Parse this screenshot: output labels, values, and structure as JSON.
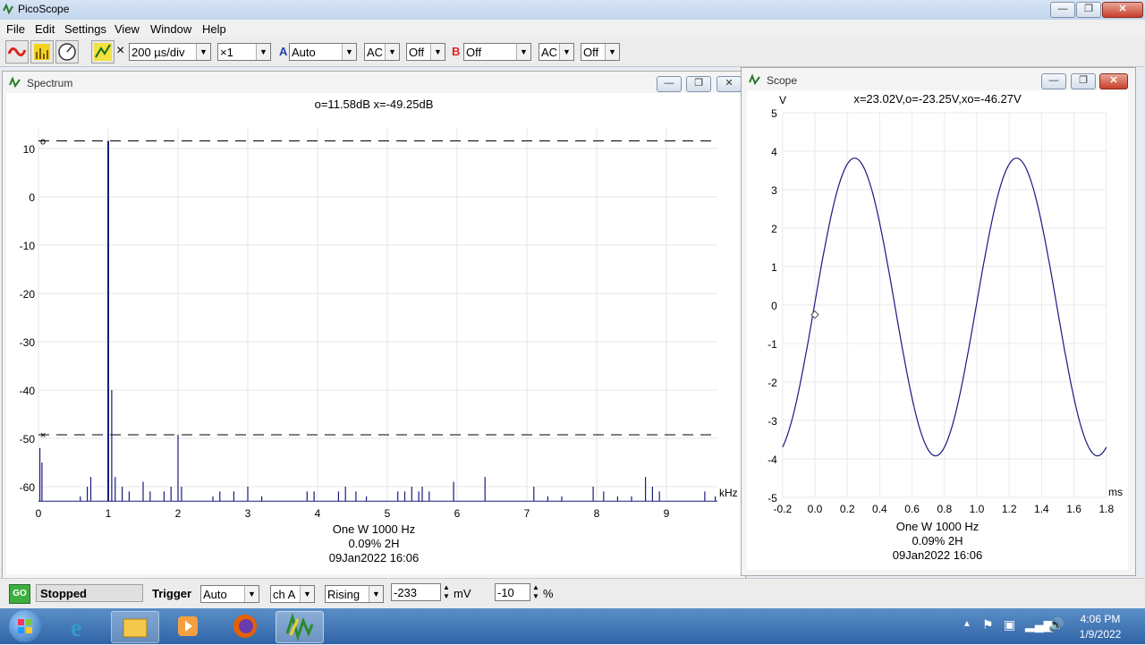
{
  "app": {
    "title": "PicoScope"
  },
  "menu": [
    "File",
    "Edit",
    "Settings",
    "View",
    "Window",
    "Help"
  ],
  "toolbar": {
    "x_symbol": "×",
    "timebase": "200 µs/div",
    "zoom": "×1",
    "channel_a": {
      "label": "A",
      "range": "Auto",
      "coupling": "AC",
      "extra": "Off"
    },
    "channel_b": {
      "label": "B",
      "range": "Off",
      "coupling": "AC",
      "extra": "Off"
    }
  },
  "spectrum": {
    "title": "Spectrum",
    "readout": "o=11.58dB  x=-49.25dB",
    "marker_o": "o",
    "marker_x": "×",
    "y_ticks": [
      "10",
      "0",
      "-10",
      "-20",
      "-30",
      "-40",
      "-50",
      "-60"
    ],
    "x_ticks": [
      "0",
      "1",
      "2",
      "3",
      "4",
      "5",
      "6",
      "7",
      "8",
      "9"
    ],
    "x_unit": "kHz",
    "info_line1": "One W 1000 Hz",
    "info_line2": "0.09% 2H",
    "info_line3": "09Jan2022  16:06"
  },
  "scope": {
    "title": "Scope",
    "y_unit": "V",
    "readout": "x=23.02V,o=-23.25V,xo=-46.27V",
    "y_ticks": [
      "5",
      "4",
      "3",
      "2",
      "1",
      "0",
      "-1",
      "-2",
      "-3",
      "-4",
      "-5"
    ],
    "x_ticks": [
      "-0.2",
      "0.0",
      "0.2",
      "0.4",
      "0.6",
      "0.8",
      "1.0",
      "1.2",
      "1.4",
      "1.6",
      "1.8"
    ],
    "x_unit": "ms",
    "info_line1": "One W 1000 Hz",
    "info_line2": "0.09% 2H",
    "info_line3": "09Jan2022  16:06"
  },
  "status": {
    "go_label": "GO",
    "state": "Stopped",
    "trigger_label": "Trigger",
    "trigger_mode": "Auto",
    "trigger_channel": "ch A",
    "trigger_edge": "Rising",
    "trigger_level": "-233",
    "level_unit": "mV",
    "pretrigger": "-10",
    "pretrigger_unit": "%"
  },
  "clock": {
    "time": "4:06 PM",
    "date": "1/9/2022"
  },
  "colors": {
    "trace": "#1a1a80",
    "accent_red": "#d22",
    "titlebar": "#c3d6ee"
  }
}
